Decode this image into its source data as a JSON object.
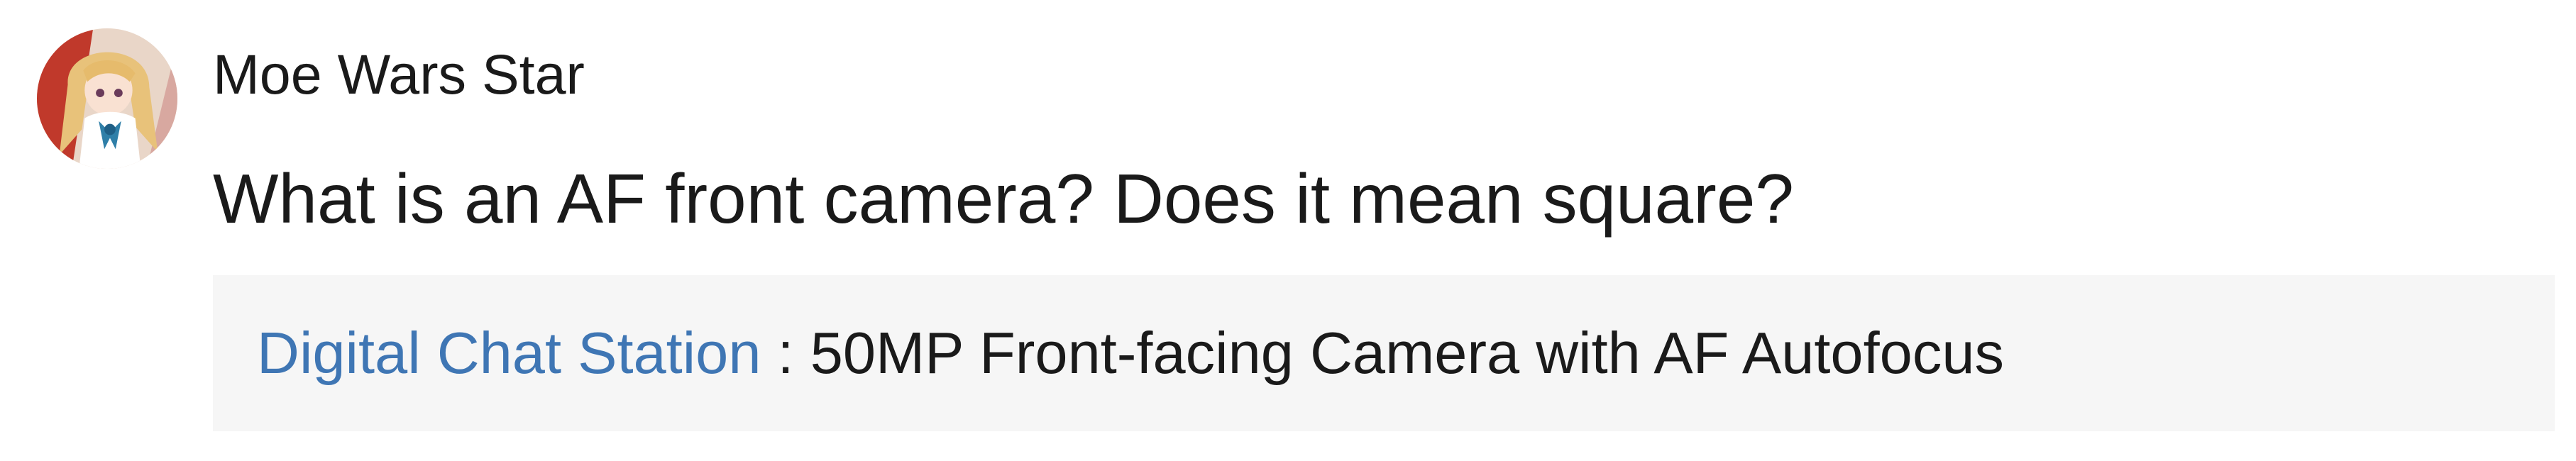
{
  "comment": {
    "username": "Moe Wars Star",
    "text": "What is an AF front camera? Does it mean square?",
    "quote": {
      "author": "Digital Chat Station",
      "separator": " : ",
      "text": "50MP Front-facing Camera with AF Autofocus"
    }
  },
  "colors": {
    "link": "#3f76b4",
    "quote_background": "#f6f6f6",
    "text": "#1a1a1a"
  }
}
